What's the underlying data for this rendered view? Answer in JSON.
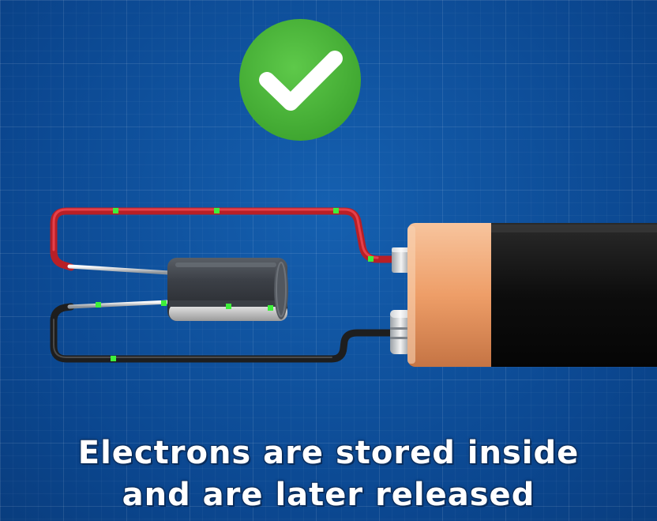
{
  "caption": {
    "line1": "Electrons are stored inside",
    "line2": "and are later released"
  },
  "colors": {
    "checkmark_green": "#4fb83c",
    "positive_wire": "#d7262e",
    "negative_wire": "#222222",
    "electron": "#3ef03a",
    "battery_copper": "#f0a06a",
    "battery_black": "#101010",
    "capacitor_body": "#3b3f45"
  },
  "icons": {
    "status": "checkmark-icon"
  }
}
